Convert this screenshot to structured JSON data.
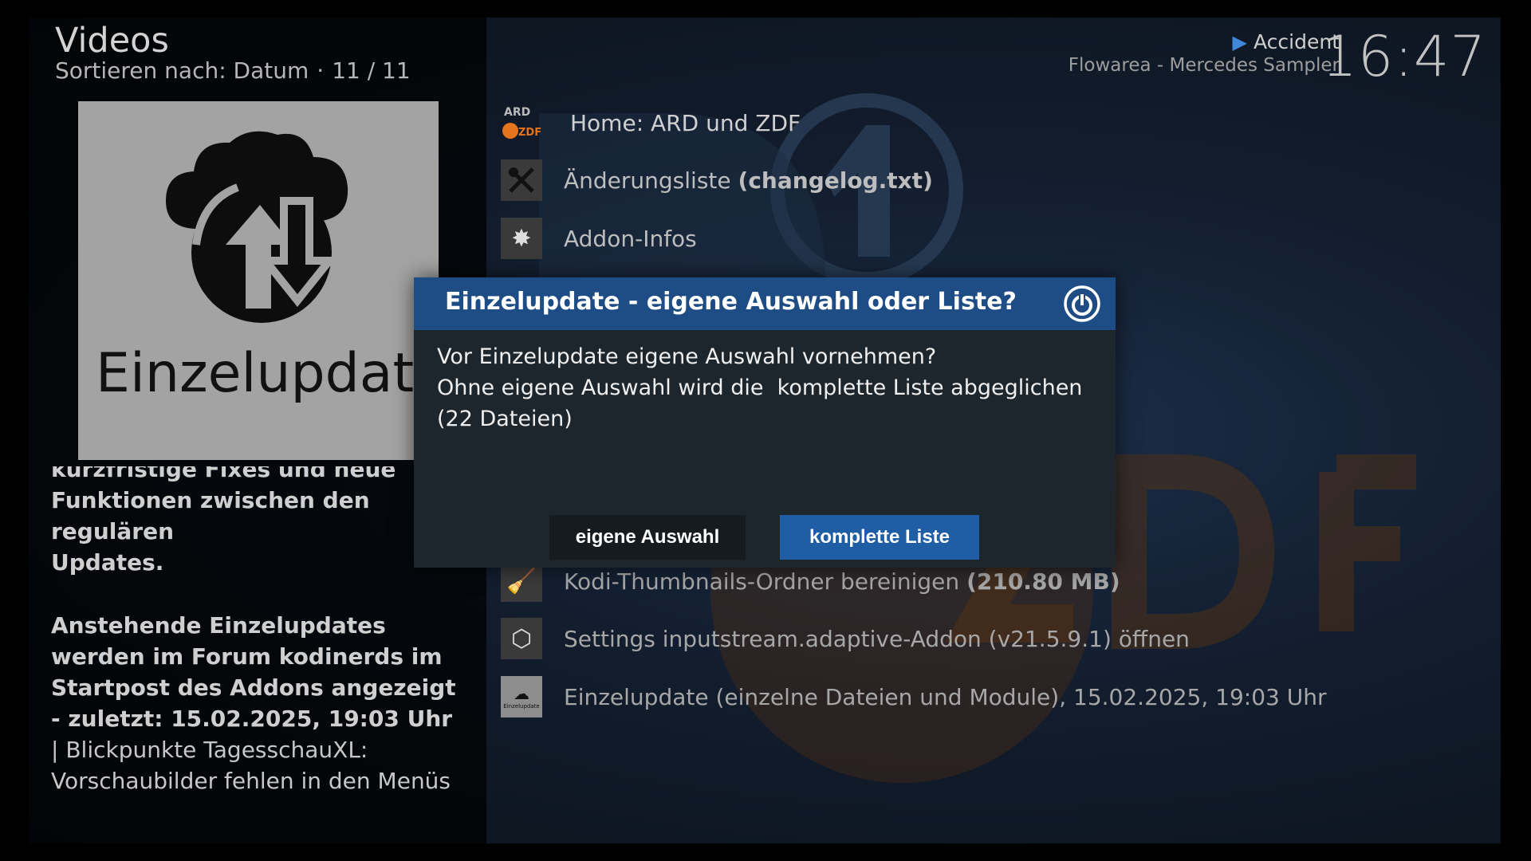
{
  "header": {
    "title": "Videos",
    "sort_label": "Sortieren nach: Datum",
    "separator": "·",
    "count": "11 / 11"
  },
  "now_playing": {
    "title": "Accident",
    "subtitle": "Flowarea - Mercedes Sampler"
  },
  "clock": "16:47",
  "thumbnail": {
    "label": "Einzelupdate"
  },
  "description": {
    "partial_top": "kurzfristige Fixes und neue",
    "line2": "Funktionen zwischen den regulären",
    "line3": "Updates.",
    "bold_text": "Anstehende Einzelupdates werden im Forum kodinerds im Startpost des Addons angezeigt - zuletzt: 15.02.2025, 19:03 Uhr",
    "pipe": "|",
    "regular_text": "Blickpunkte TagesschauXL:  Vorschaubilder fehlen in den Menüs  Bilder des Tages, Blickpunkte und aktuelle Bildergalerien -"
  },
  "list": {
    "home": {
      "logo_top": "ARD",
      "logo_bottom": "ZDF",
      "label": "Home: ARD und ZDF"
    },
    "changelog": {
      "label": "Änderungsliste",
      "label_bold": "(changelog.txt)"
    },
    "addon_info": {
      "label": "Addon-Infos"
    },
    "thumbnails": {
      "label": "Kodi-Thumbnails-Ordner bereinigen",
      "label_bold": "(210.80 MB)"
    },
    "inputstream": {
      "label": "Settings inputstream.adaptive-Addon (v21.5.9.1) öffnen"
    },
    "einzelupdate": {
      "label": "Einzelupdate (einzelne Dateien und Module), 15.02.2025, 19:03 Uhr",
      "icon_text": "Einzelupdate"
    }
  },
  "dialog": {
    "title": "Einzelupdate - eigene Auswahl oder Liste?",
    "line1": "Vor Einzelupdate eigene Auswahl vornehmen?",
    "line2": "Ohne eigene Auswahl wird die  komplette Liste abgeglichen (22 Dateien)",
    "button_own": "eigene Auswahl",
    "button_full": "komplette Liste"
  },
  "colors": {
    "dialog_header": "#1e4c84",
    "button_focused": "#1f5da5",
    "accent_play": "#3f87d9",
    "zdf_orange": "#e6731e"
  },
  "icons": {
    "changelog": "wrench-screwdriver-icon",
    "addon_info": "gear-icon",
    "thumbnails": "broom-icon",
    "inputstream": "package-icon",
    "power": "power-icon",
    "cloud": "cloud-sync-icon"
  }
}
